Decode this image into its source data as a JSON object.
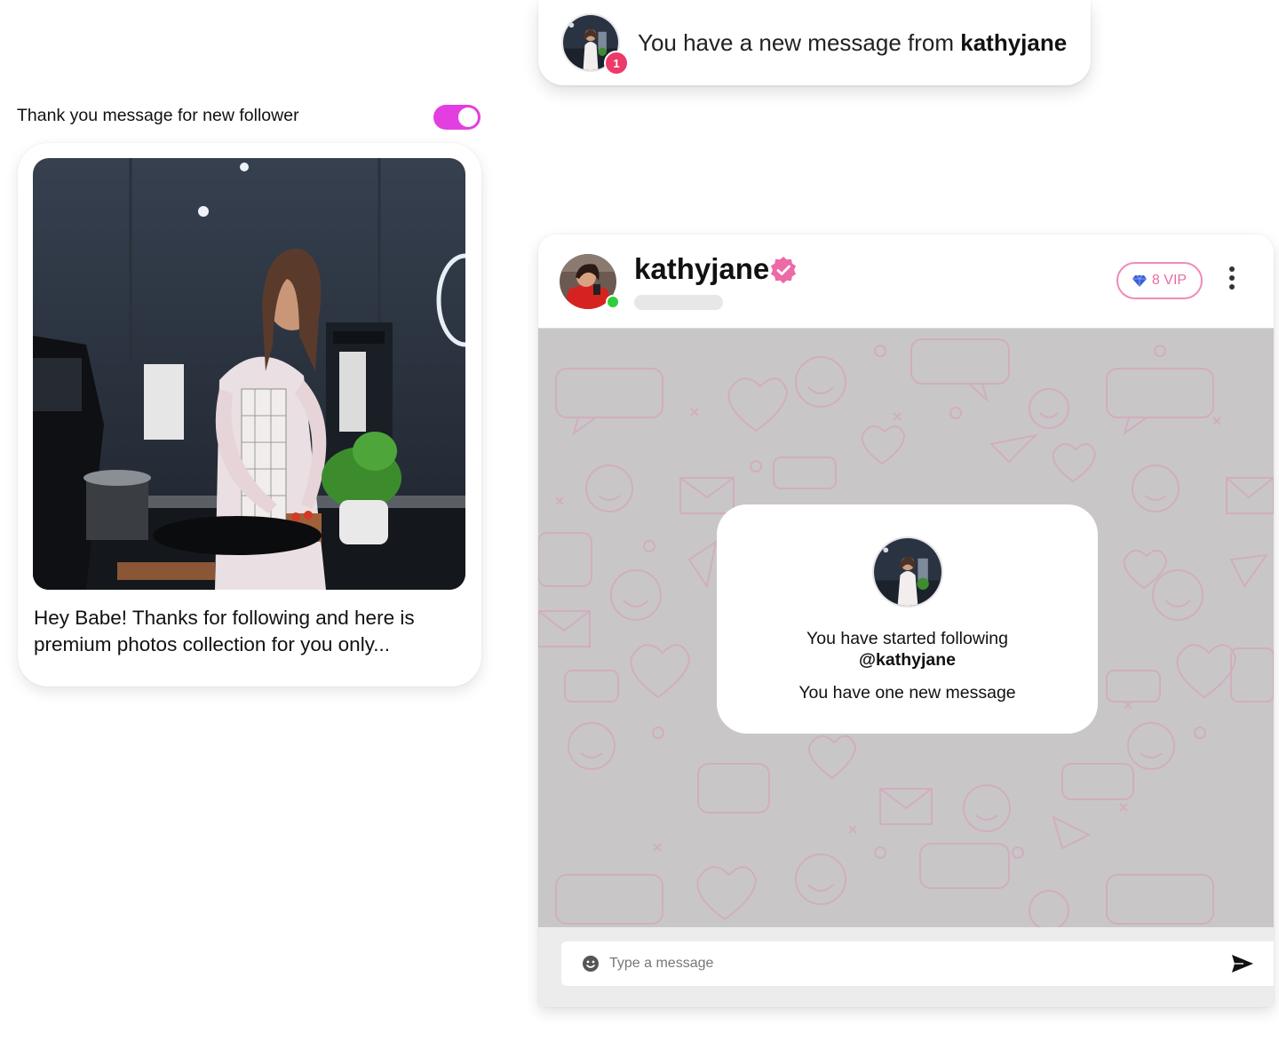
{
  "notification": {
    "text_prefix": "You have a new message from",
    "username": "kathyjane",
    "badge_count": "1"
  },
  "setting": {
    "label": "Thank you message for new follower",
    "enabled": true
  },
  "preview": {
    "message": "Hey Babe! Thanks for following and here is premium photos collection for you only..."
  },
  "chat": {
    "username": "kathyjane",
    "verified": true,
    "online": true,
    "vip_label": "8 VIP",
    "follow_line1": "You have started following",
    "follow_handle": "@kathyjane",
    "follow_line3": "You have one new message",
    "input_placeholder": "Type a message"
  },
  "colors": {
    "accent_pink": "#ec6aa5",
    "toggle_magenta": "#e33ee0",
    "online_green": "#2fce3e",
    "badge_red": "#ec3a6a",
    "chat_background": "#c9c6c8"
  },
  "icons": [
    "verified-badge-icon",
    "diamond-icon",
    "more-vertical-icon",
    "emoji-icon",
    "send-icon"
  ]
}
